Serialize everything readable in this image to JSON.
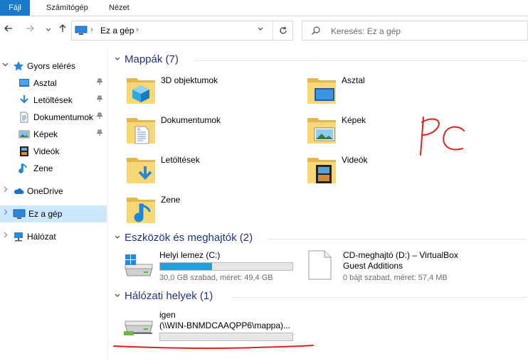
{
  "ribbon": {
    "tabs": [
      "Fájl",
      "Számítógép",
      "Nézet"
    ]
  },
  "address": {
    "path": "Ez a gép",
    "separator": "›"
  },
  "search": {
    "placeholder": "Keresés: Ez a gép"
  },
  "sidebar": {
    "items": [
      {
        "label": "Gyors elérés",
        "icon": "star-icon",
        "expanded": true
      },
      {
        "label": "Asztal",
        "icon": "desktop-icon",
        "pinned": true
      },
      {
        "label": "Letöltések",
        "icon": "download-icon",
        "pinned": true
      },
      {
        "label": "Dokumentumok",
        "icon": "document-icon",
        "pinned": true
      },
      {
        "label": "Képek",
        "icon": "picture-icon",
        "pinned": true
      },
      {
        "label": "Videók",
        "icon": "video-icon"
      },
      {
        "label": "Zene",
        "icon": "music-icon"
      },
      {
        "label": "OneDrive",
        "icon": "cloud-icon"
      },
      {
        "label": "Ez a gép",
        "icon": "computer-icon",
        "selected": true
      },
      {
        "label": "Hálózat",
        "icon": "network-icon"
      }
    ]
  },
  "groups": {
    "folders": {
      "title": "Mappák (7)",
      "items": [
        {
          "label": "3D objektumok",
          "icon": "3d-objects-icon"
        },
        {
          "label": "Asztal",
          "icon": "desktop-folder-icon"
        },
        {
          "label": "Dokumentumok",
          "icon": "documents-folder-icon"
        },
        {
          "label": "Képek",
          "icon": "pictures-folder-icon"
        },
        {
          "label": "Letöltések",
          "icon": "downloads-folder-icon"
        },
        {
          "label": "Videók",
          "icon": "videos-folder-icon"
        },
        {
          "label": "Zene",
          "icon": "music-folder-icon"
        }
      ]
    },
    "devices": {
      "title": "Eszközök és meghajtók (2)",
      "items": [
        {
          "name": "Helyi lemez (C:)",
          "info": "30,0 GB szabad, méret: 49,4 GB",
          "used_fraction": 0.39,
          "icon": "windows-drive-icon"
        },
        {
          "name": "CD-meghajtó (D:) – VirtualBox",
          "subname": "Guest Additions",
          "info": "0 bájt szabad, méret: 57,4 MB",
          "icon": "cd-drive-icon"
        }
      ]
    },
    "network": {
      "title": "Hálózati helyek (1)",
      "items": [
        {
          "name": "igen",
          "subname": "(\\\\WIN-BNMDCAAQPP6\\mappa)...",
          "used_fraction": 0.0,
          "icon": "network-drive-icon"
        }
      ]
    }
  },
  "annotation": {
    "text": "PC",
    "color": "#e0201b"
  },
  "colors": {
    "accent": "#1979ca",
    "selection": "#cce8ff",
    "group_title": "#1e3287",
    "bar_fill": "#26a0da"
  }
}
